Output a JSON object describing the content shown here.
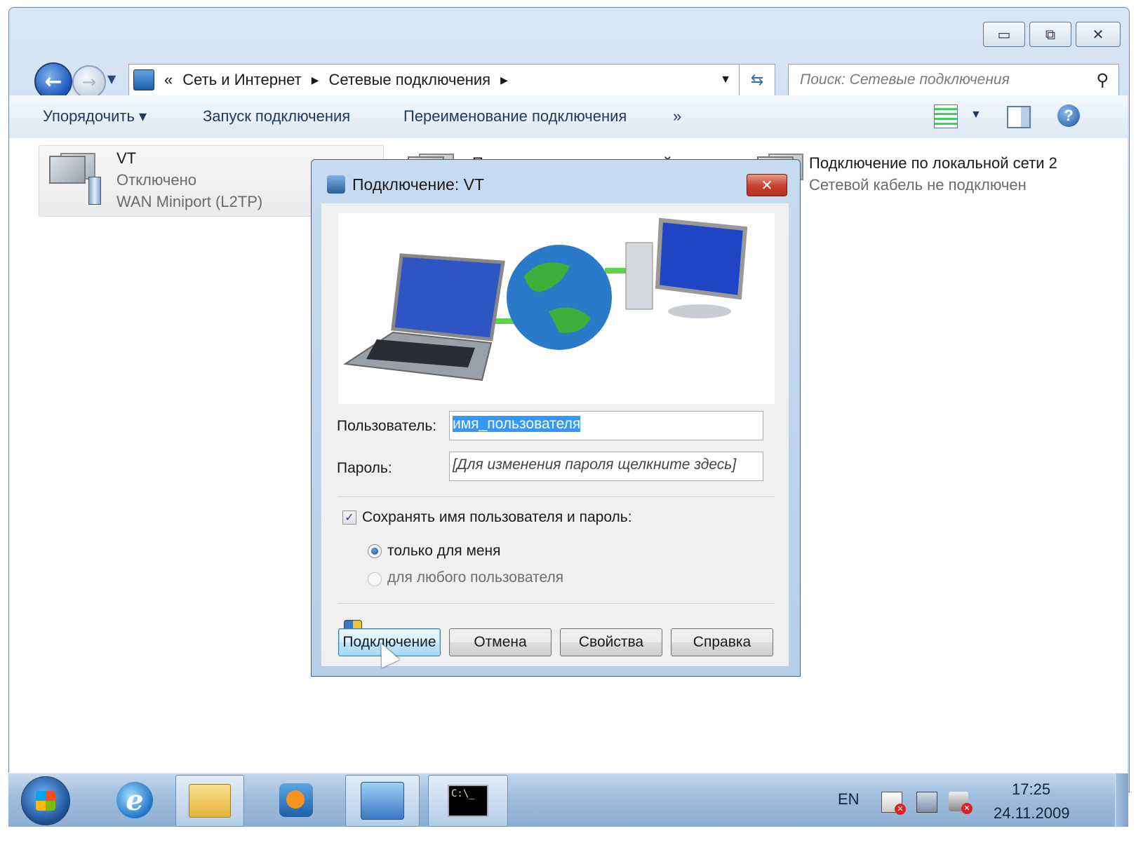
{
  "window": {
    "caption_buttons": {
      "minimize": "▭",
      "maximize": "⧉",
      "close": "✕"
    }
  },
  "address": {
    "overflow": "«",
    "crumbs": [
      "Сеть и Интернет",
      "Сетевые подключения"
    ],
    "search_placeholder": "Поиск: Сетевые подключения"
  },
  "toolbar": {
    "organize": "Упорядочить ▾",
    "start_connection": "Запуск подключения",
    "rename_connection": "Переименование подключения",
    "more": "»"
  },
  "connections": [
    {
      "name": "VT",
      "status": "Отключено",
      "device": "WAN Miniport (L2TP)"
    },
    {
      "name": "Подключение по локальной сети",
      "status": "",
      "device": ""
    },
    {
      "name": "Подключение по локальной сети 2",
      "status": "Сетевой кабель не подключен",
      "device": ""
    }
  ],
  "dialog": {
    "title": "Подключение: VT",
    "user_label": "Пользователь:",
    "user_value": "имя_пользователя",
    "password_label": "Пароль:",
    "password_value": "[Для изменения пароля щелкните здесь]",
    "save_label": "Сохранять имя пользователя и пароль:",
    "save_checked": true,
    "radio_me": "только для меня",
    "radio_any": "для любого пользователя",
    "buttons": {
      "connect": "Подключение",
      "cancel": "Отмена",
      "properties": "Свойства",
      "help": "Справка"
    }
  },
  "taskbar": {
    "language": "EN",
    "time": "17:25",
    "date": "24.11.2009",
    "cmd_text": "C:\\_"
  }
}
